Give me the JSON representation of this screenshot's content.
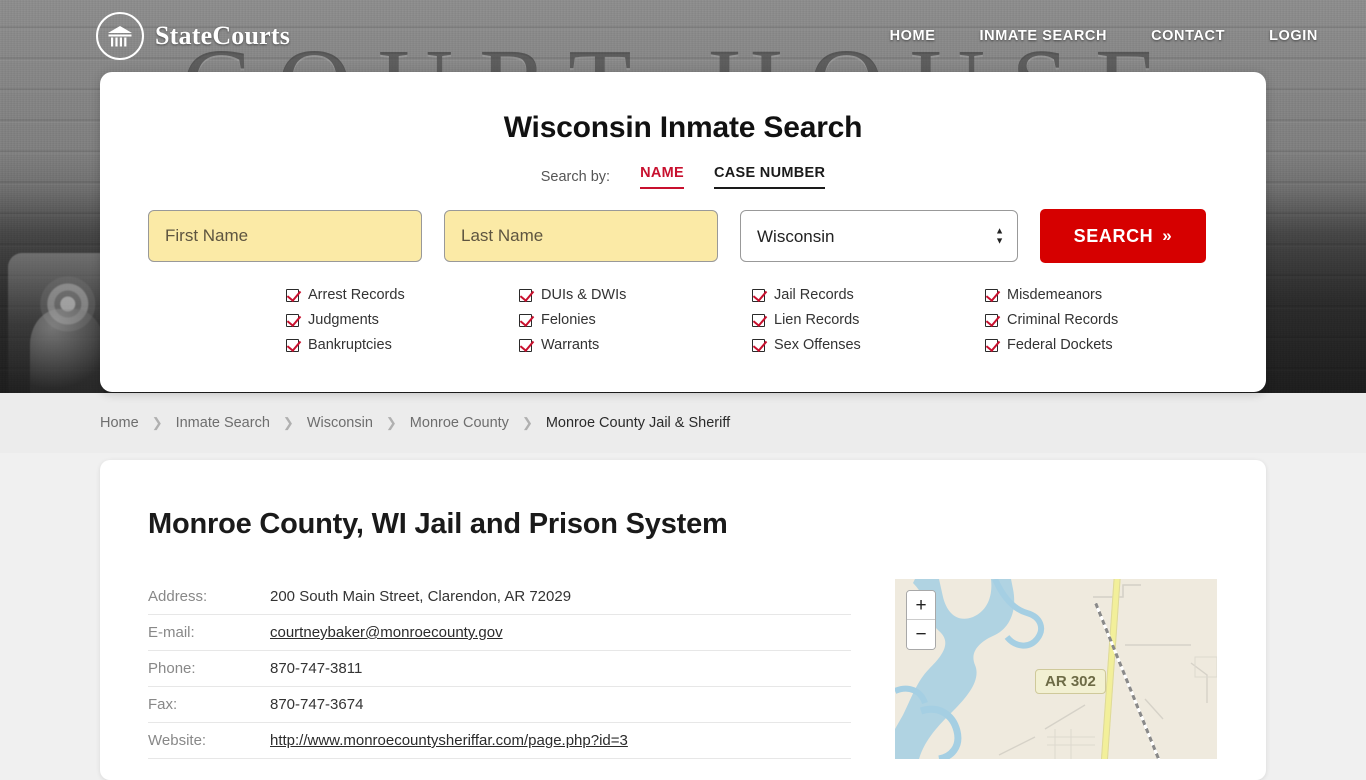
{
  "header": {
    "brand": "StateCourts",
    "brand_icon": "courthouse-circle-icon",
    "nav": [
      {
        "label": "HOME"
      },
      {
        "label": "INMATE SEARCH"
      },
      {
        "label": "CONTACT"
      },
      {
        "label": "LOGIN"
      }
    ]
  },
  "hero": {
    "background_text": "COURT HOUSE"
  },
  "search": {
    "title": "Wisconsin Inmate Search",
    "search_by_label": "Search by:",
    "tabs": [
      {
        "label": "NAME",
        "active": true
      },
      {
        "label": "CASE NUMBER",
        "active": false
      }
    ],
    "first_name_placeholder": "First Name",
    "first_name_value": "",
    "last_name_placeholder": "Last Name",
    "last_name_value": "",
    "state_selected": "Wisconsin",
    "state_options": [
      "Wisconsin"
    ],
    "submit_label": "SEARCH",
    "submit_chevron": "»",
    "accent_color": "#c8102e",
    "button_color": "#d60000",
    "field_highlight_color": "#fbeaa6",
    "record_types": [
      "Arrest Records",
      "DUIs & DWIs",
      "Jail Records",
      "Misdemeanors",
      "Judgments",
      "Felonies",
      "Lien Records",
      "Criminal Records",
      "Bankruptcies",
      "Warrants",
      "Sex Offenses",
      "Federal Dockets"
    ]
  },
  "breadcrumb": {
    "separator": "❯",
    "items": [
      {
        "label": "Home",
        "current": false
      },
      {
        "label": "Inmate Search",
        "current": false
      },
      {
        "label": "Wisconsin",
        "current": false
      },
      {
        "label": "Monroe County",
        "current": false
      },
      {
        "label": "Monroe County Jail & Sheriff",
        "current": true
      }
    ]
  },
  "content": {
    "page_title": "Monroe County, WI Jail and Prison System",
    "details": [
      {
        "label": "Address:",
        "value": "200 South Main Street, Clarendon, AR 72029",
        "is_link": false
      },
      {
        "label": "E-mail:",
        "value": "courtneybaker@monroecounty.gov",
        "is_link": true
      },
      {
        "label": "Phone:",
        "value": "870-747-3811",
        "is_link": false
      },
      {
        "label": "Fax:",
        "value": "870-747-3674",
        "is_link": false
      },
      {
        "label": "Website:",
        "value": "http://www.monroecountysheriffar.com/page.php?id=3",
        "is_link": true
      }
    ]
  },
  "map": {
    "zoom_in_label": "+",
    "zoom_out_label": "−",
    "highway_label": "AR 302",
    "water_color": "#a5cfe3",
    "land_color": "#efeade",
    "highway_color": "#f2ef9a"
  }
}
